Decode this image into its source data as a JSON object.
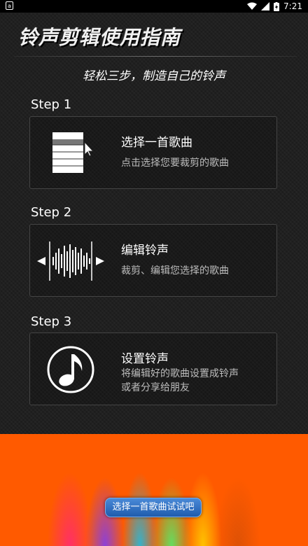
{
  "status_bar": {
    "time": "7:21",
    "left_icon": "a"
  },
  "title": "铃声剪辑使用指南",
  "subtitle": "轻松三步，制造自己的铃声",
  "steps": [
    {
      "label": "Step 1",
      "title": "选择一首歌曲",
      "desc": "点击选择您要裁剪的歌曲",
      "icon": "list-select-icon"
    },
    {
      "label": "Step 2",
      "title": "编辑铃声",
      "desc": "裁剪、编辑您选择的歌曲",
      "icon": "waveform-icon"
    },
    {
      "label": "Step 3",
      "title": "设置铃声",
      "desc_line1": "将编辑好的歌曲设置成铃声",
      "desc_line2": "或者分享给朋友",
      "icon": "music-note-icon"
    }
  ],
  "cta_label": "选择一首歌曲试试吧"
}
